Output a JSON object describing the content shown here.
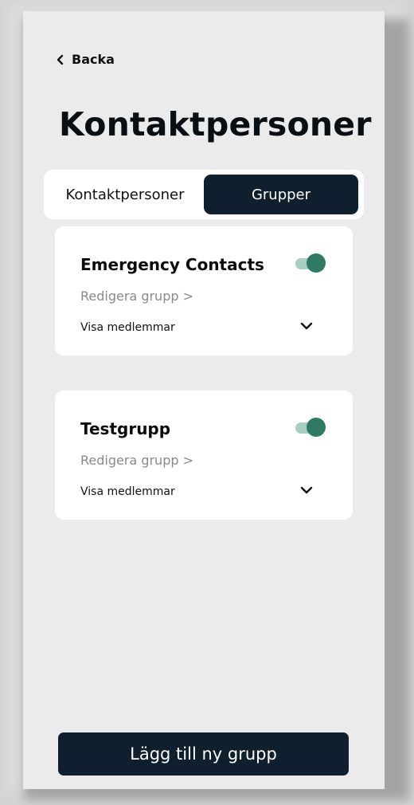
{
  "nav": {
    "back_label": "Backa"
  },
  "page": {
    "title": "Kontaktpersoner"
  },
  "tabs": {
    "contacts_label": "Kontaktpersoner",
    "groups_label": "Grupper",
    "active": "Grupper"
  },
  "groups": [
    {
      "name": "Emergency Contacts",
      "enabled": true,
      "edit_label": "Redigera grupp >",
      "members_label": "Visa medlemmar"
    },
    {
      "name": "Testgrupp",
      "enabled": true,
      "edit_label": "Redigera grupp >",
      "members_label": "Visa medlemmar"
    }
  ],
  "actions": {
    "add_group_label": "Lägg till ny grupp"
  },
  "colors": {
    "primary_dark": "#0f1f2e",
    "toggle_on": "#2f7a64",
    "toggle_track": "#a9cfc2",
    "background": "#ebebeb"
  },
  "icons": {
    "back": "chevron-left-icon",
    "expand": "chevron-down-icon"
  }
}
